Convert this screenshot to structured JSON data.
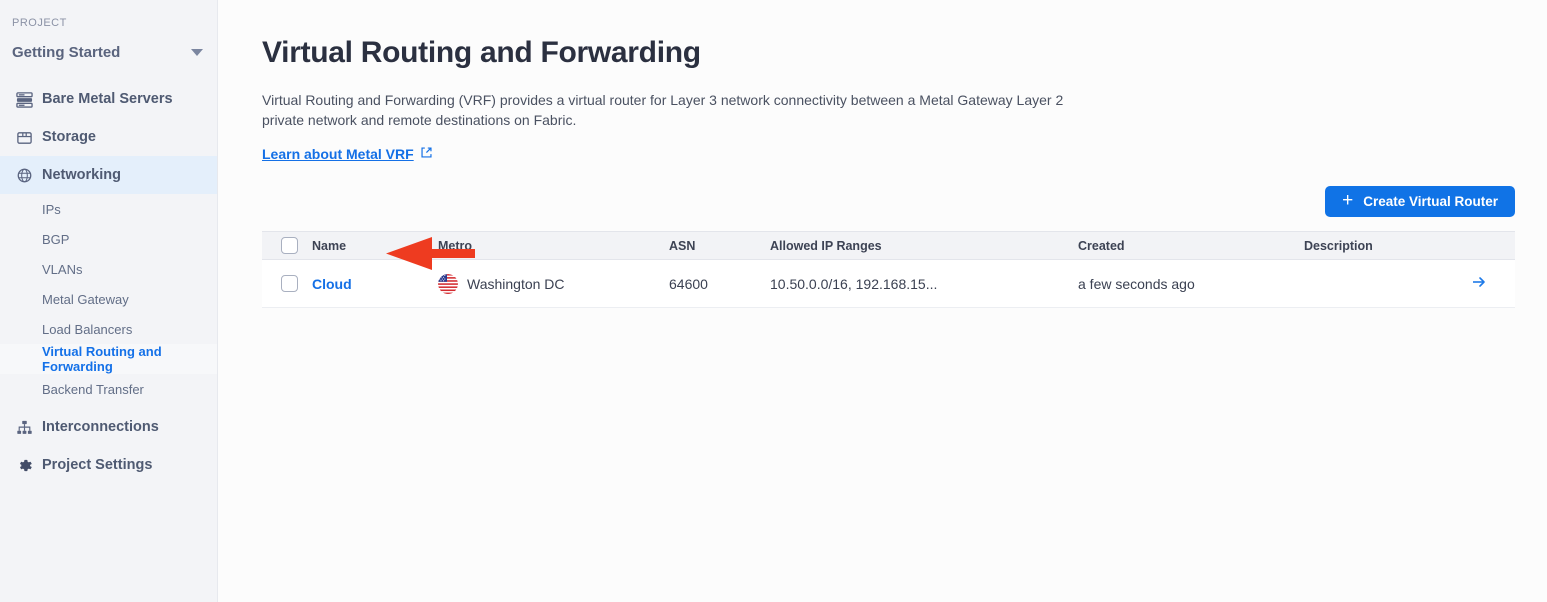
{
  "sidebar": {
    "project_label": "PROJECT",
    "project_name": "Getting Started",
    "items": [
      {
        "label": "Bare Metal Servers",
        "icon": "server-icon"
      },
      {
        "label": "Storage",
        "icon": "storage-icon"
      },
      {
        "label": "Networking",
        "icon": "globe-icon"
      },
      {
        "label": "Interconnections",
        "icon": "sitemap-icon"
      },
      {
        "label": "Project Settings",
        "icon": "gear-icon"
      }
    ],
    "subitems": [
      {
        "label": "IPs"
      },
      {
        "label": "BGP"
      },
      {
        "label": "VLANs"
      },
      {
        "label": "Metal Gateway"
      },
      {
        "label": "Load Balancers"
      },
      {
        "label": "Virtual Routing and Forwarding"
      },
      {
        "label": "Backend Transfer"
      }
    ]
  },
  "main": {
    "title": "Virtual Routing and Forwarding",
    "description": "Virtual Routing and Forwarding (VRF) provides a virtual router for Layer 3 network connectivity between a Metal Gateway Layer 2 private network and remote destinations on Fabric.",
    "learn_link": "Learn about Metal VRF",
    "create_button": "Create Virtual Router",
    "create_button_plus": "+"
  },
  "table": {
    "columns": [
      "",
      "Name",
      "Metro",
      "ASN",
      "Allowed IP Ranges",
      "Created",
      "Description",
      ""
    ],
    "rows": [
      {
        "name": "Cloud",
        "metro": "Washington DC",
        "metro_flag": "us-flag-icon",
        "asn": "64600",
        "allowed_ip_ranges": "10.50.0.0/16, 192.168.15...",
        "created": "a few seconds ago",
        "description": ""
      }
    ]
  },
  "colors": {
    "accent_blue": "#1073e6",
    "link_blue": "#1470e6",
    "sidebar_bg": "#f3f4f7",
    "sidebar_active_bg": "#e4effb",
    "table_header_bg": "#f2f3f6",
    "annotation_red": "#ee3b20"
  },
  "annotation": {
    "type": "arrow-left",
    "color": "#ee3b20"
  }
}
